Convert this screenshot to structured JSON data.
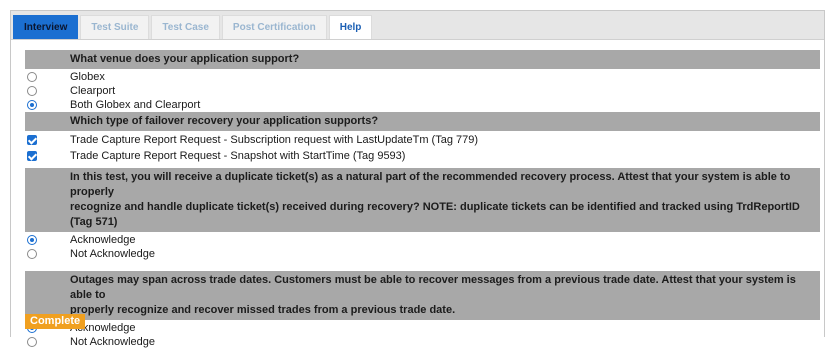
{
  "tabs": [
    {
      "label": "Interview"
    },
    {
      "label": "Test Suite"
    },
    {
      "label": "Test Case"
    },
    {
      "label": "Post Certification"
    },
    {
      "label": "Help"
    }
  ],
  "questions": [
    {
      "text": "What venue does your application support?",
      "type": "radio",
      "options": [
        {
          "label": "Globex",
          "selected": false
        },
        {
          "label": "Clearport",
          "selected": false
        },
        {
          "label": "Both Globex and Clearport",
          "selected": true
        }
      ]
    },
    {
      "text": "Which type of failover recovery your application supports?",
      "type": "checkbox",
      "options": [
        {
          "label": "Trade Capture Report Request - Subscription request with LastUpdateTm (Tag 779)",
          "selected": true
        },
        {
          "label": "Trade Capture Report Request - Snapshot with StartTime (Tag 9593)",
          "selected": true
        }
      ]
    },
    {
      "text_lines": [
        "In this test, you will receive a duplicate ticket(s) as a natural part of the recommended recovery process. Attest that your system is able to properly",
        "recognize and handle duplicate ticket(s) received during recovery? NOTE: duplicate tickets can be identified and tracked using TrdReportID (Tag 571)"
      ],
      "type": "radio",
      "options": [
        {
          "label": "Acknowledge",
          "selected": true
        },
        {
          "label": "Not Acknowledge",
          "selected": false
        }
      ]
    },
    {
      "text_lines": [
        "Outages may span across trade dates. Customers must be able to recover messages from a previous trade date. Attest that your system is able to",
        "properly recognize and recover missed trades from a previous trade date."
      ],
      "type": "radio",
      "options": [
        {
          "label": "Acknowledge",
          "selected": true
        },
        {
          "label": "Not Acknowledge",
          "selected": false
        }
      ]
    }
  ],
  "complete_label": "Complete",
  "colors": {
    "active_tab": "#1b6fd1",
    "question_header": "#a8a8a8",
    "complete_button": "#f0a020",
    "control_selected": "#1b6fd1"
  }
}
